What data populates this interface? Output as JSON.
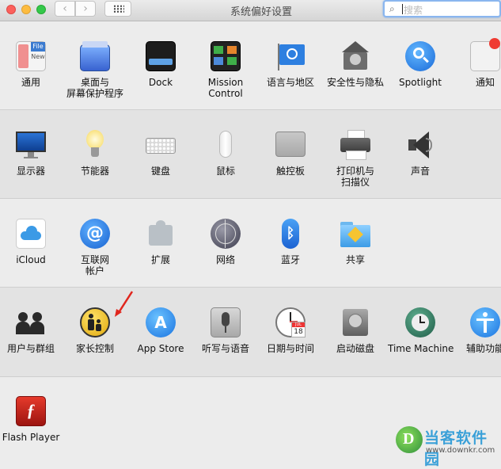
{
  "window": {
    "title": "系统偏好设置"
  },
  "toolbar": {
    "back": "‹",
    "forward": "›"
  },
  "search": {
    "placeholder": "搜索"
  },
  "row1": [
    {
      "label": "通用",
      "icon": "general-icon"
    },
    {
      "label": "桌面与\n屏幕保护程序",
      "icon": "desktop-screensaver-icon"
    },
    {
      "label": "Dock",
      "icon": "dock-icon"
    },
    {
      "label": "Mission\nControl",
      "icon": "mission-control-icon"
    },
    {
      "label": "语言与地区",
      "icon": "language-region-icon"
    },
    {
      "label": "安全性与隐私",
      "icon": "security-privacy-icon"
    },
    {
      "label": "Spotlight",
      "icon": "spotlight-icon"
    },
    {
      "label": "通知",
      "icon": "notifications-icon"
    }
  ],
  "row2": [
    {
      "label": "显示器",
      "icon": "displays-icon"
    },
    {
      "label": "节能器",
      "icon": "energy-saver-icon"
    },
    {
      "label": "键盘",
      "icon": "keyboard-icon"
    },
    {
      "label": "鼠标",
      "icon": "mouse-icon"
    },
    {
      "label": "触控板",
      "icon": "trackpad-icon"
    },
    {
      "label": "打印机与\n扫描仪",
      "icon": "printers-scanners-icon"
    },
    {
      "label": "声音",
      "icon": "sound-icon"
    }
  ],
  "row3": [
    {
      "label": "iCloud",
      "icon": "icloud-icon"
    },
    {
      "label": "互联网\n帐户",
      "icon": "internet-accounts-icon"
    },
    {
      "label": "扩展",
      "icon": "extensions-icon"
    },
    {
      "label": "网络",
      "icon": "network-icon"
    },
    {
      "label": "蓝牙",
      "icon": "bluetooth-icon"
    },
    {
      "label": "共享",
      "icon": "sharing-icon"
    }
  ],
  "row4": [
    {
      "label": "用户与群组",
      "icon": "users-groups-icon"
    },
    {
      "label": "家长控制",
      "icon": "parental-controls-icon"
    },
    {
      "label": "App Store",
      "icon": "app-store-icon"
    },
    {
      "label": "听写与语音",
      "icon": "dictation-speech-icon"
    },
    {
      "label": "日期与时间",
      "icon": "date-time-icon"
    },
    {
      "label": "启动磁盘",
      "icon": "startup-disk-icon"
    },
    {
      "label": "Time Machine",
      "icon": "time-machine-icon"
    },
    {
      "label": "辅助功能",
      "icon": "accessibility-icon"
    }
  ],
  "row5": [
    {
      "label": "Flash Player",
      "icon": "flash-player-icon"
    }
  ],
  "icon_text": {
    "general_file": "File",
    "general_new": "New",
    "calendar_month": "JUL",
    "calendar_day": "18"
  },
  "watermark": {
    "name": "当客软件园",
    "url": "www.downkr.com",
    "logo_letter": "D"
  }
}
